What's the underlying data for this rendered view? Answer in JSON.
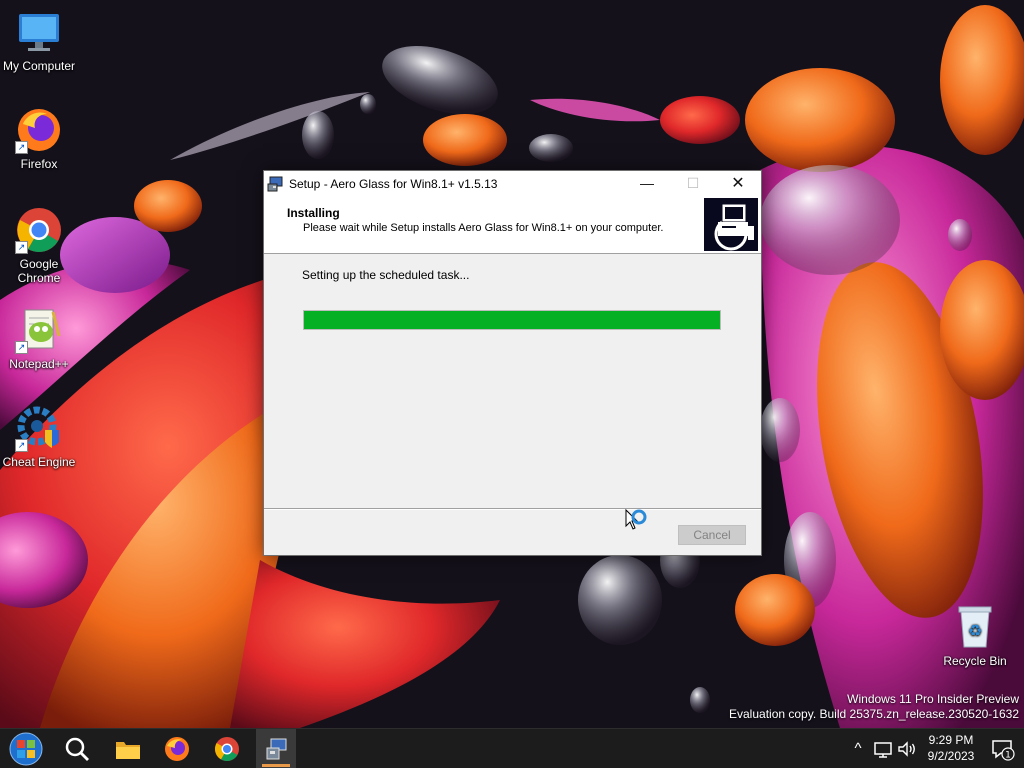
{
  "desktop": {
    "icons": [
      {
        "label": "My Computer",
        "icon": "monitor-icon"
      },
      {
        "label": "Firefox",
        "icon": "firefox-icon"
      },
      {
        "label": "Google Chrome",
        "icon": "chrome-icon"
      },
      {
        "label": "Notepad++",
        "icon": "notepadpp-icon"
      },
      {
        "label": "Cheat Engine",
        "icon": "cheat-engine-icon"
      },
      {
        "label": "Recycle Bin",
        "icon": "recycle-bin-icon"
      }
    ],
    "watermark_line1": "Windows 11 Pro Insider Preview",
    "watermark_line2": "Evaluation copy. Build 25375.zn_release.230520-1632"
  },
  "setup_window": {
    "title": "Setup - Aero Glass for Win8.1+ v1.5.13",
    "minimize_symbol": "—",
    "maximize_symbol": "☐",
    "close_symbol": "✕",
    "header_heading": "Installing",
    "header_subtitle": "Please wait while Setup installs Aero Glass for Win8.1+ on your computer.",
    "status_text": "Setting up the scheduled task...",
    "progress_percent": 100,
    "cancel_label": "Cancel",
    "colors": {
      "progress": "#06b025",
      "logo_bg": "#08081e"
    }
  },
  "taskbar": {
    "apps": [
      {
        "name": "Start",
        "icon": "windows-start-icon"
      },
      {
        "name": "Search",
        "icon": "search-icon"
      },
      {
        "name": "File Explorer",
        "icon": "folder-icon"
      },
      {
        "name": "Firefox",
        "icon": "firefox-icon"
      },
      {
        "name": "Google Chrome",
        "icon": "chrome-icon"
      },
      {
        "name": "Setup",
        "icon": "setup-installer-icon",
        "active": true
      }
    ],
    "tray": {
      "chevron": "^",
      "notification_count": "1"
    },
    "clock_time": "9:29 PM",
    "clock_date": "9/2/2023"
  }
}
